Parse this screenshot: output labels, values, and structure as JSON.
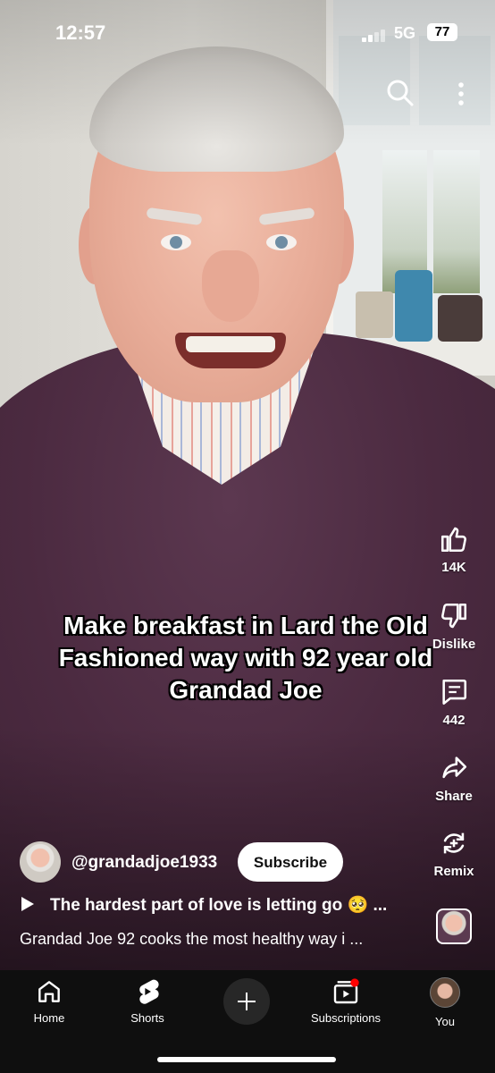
{
  "status_bar": {
    "time": "12:57",
    "network": "5G",
    "battery": "77"
  },
  "top_actions": {
    "search_icon": "search-icon",
    "more_icon": "more-vert-icon"
  },
  "video": {
    "caption": "Make breakfast in Lard the Old Fashioned way with 92 year old Grandad Joe"
  },
  "actions": {
    "like_count": "14K",
    "dislike_label": "Dislike",
    "comment_count": "442",
    "share_label": "Share",
    "remix_label": "Remix"
  },
  "channel": {
    "handle": "@grandadjoe1933",
    "subscribe_label": "Subscribe"
  },
  "playlist": {
    "title": "The hardest part of love is letting go 🥺 ..."
  },
  "description": {
    "text": "Grandad Joe 92 cooks the most healthy way i ..."
  },
  "nav": {
    "home": "Home",
    "shorts": "Shorts",
    "subscriptions": "Subscriptions",
    "you": "You"
  },
  "colors": {
    "nav_bg": "#0f0f0f",
    "notification_dot": "#ff0000",
    "subscribe_bg": "#ffffff"
  }
}
